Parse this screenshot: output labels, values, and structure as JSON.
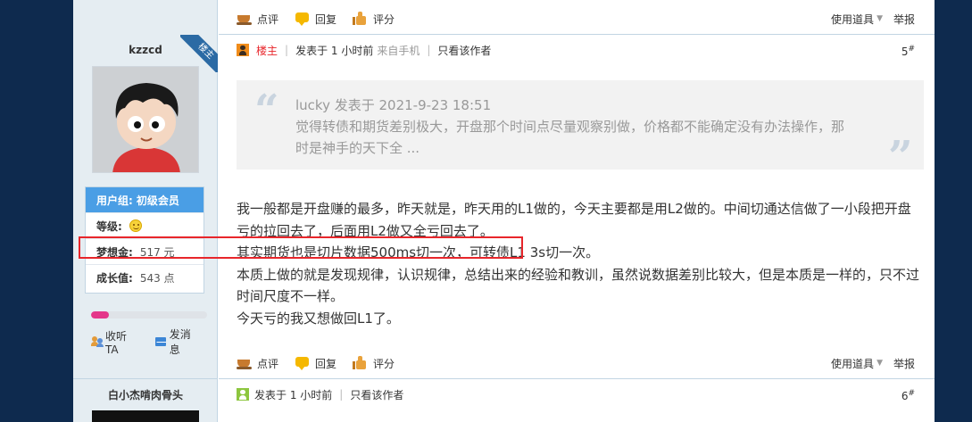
{
  "actions_bar": {
    "rate_label": "点评",
    "reply_label": "回复",
    "score_label": "评分",
    "tools_label": "使用道具",
    "report_label": "举报"
  },
  "post": {
    "author": "kzzcd",
    "corner_badge": "楼主",
    "owner_tag": "楼主",
    "posted": "发表于 1 小时前",
    "via": "来自手机",
    "view_author_only": "只看该作者",
    "floor_number": "5",
    "floor_mark": "#",
    "quote": {
      "header": "lucky 发表于 2021-9-23 18:51",
      "body": "觉得转债和期货差别极大，开盘那个时间点尽量观察别做，价格都不能确定没有办法操作，那时是神手的天下全 ..."
    },
    "content_lines": [
      "我一般都是开盘赚的最多，昨天就是，昨天用的L1做的，今天主要都是用L2做的。中间切通达信做了一小段把开盘亏的拉回去了，后面用L2做又全亏回去了。",
      "其实期货也是切片数据500ms切一次，可转债L1 3s切一次。",
      "本质上做的就是发现规律，认识规律，总结出来的经验和教训，虽然说数据差别比较大，但是本质是一样的，只不过时间尺度不一样。",
      "今天亏的我又想做回L1了。"
    ]
  },
  "profile": {
    "group_label": "用户组:",
    "group_value": "初级会员",
    "level_label": "等级:",
    "coins_label": "梦想金:",
    "coins_value": "517 元",
    "growth_label": "成长值:",
    "growth_value": "543 点",
    "progress": 0.15,
    "follow_label": "收听TA",
    "message_label": "发消息"
  },
  "next_post": {
    "author": "白小杰啃肉骨头",
    "posted": "发表于 1 小时前",
    "view_author_only": "只看该作者",
    "floor_number": "6",
    "floor_mark": "#"
  },
  "colors": {
    "highlight_box": "#e8262b",
    "group_row": "#4a9ee5",
    "owner_tag": "#e8262b"
  }
}
